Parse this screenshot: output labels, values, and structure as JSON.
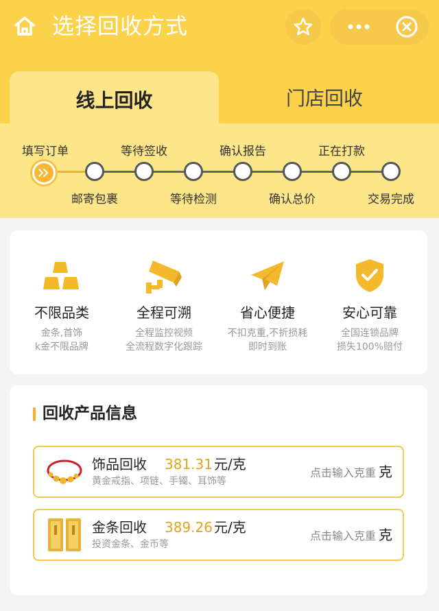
{
  "header": {
    "title": "选择回收方式",
    "icons": {
      "home": "home-icon",
      "favorite": "star-icon",
      "more": "more-icon",
      "close": "close-icon"
    }
  },
  "tabs": [
    {
      "label": "线上回收",
      "active": true
    },
    {
      "label": "门店回收",
      "active": false
    }
  ],
  "steps": [
    {
      "label": "填写订单",
      "current": true
    },
    {
      "label": "邮寄包裹"
    },
    {
      "label": "等待签收"
    },
    {
      "label": "等待检测"
    },
    {
      "label": "确认报告"
    },
    {
      "label": "确认总价"
    },
    {
      "label": "正在打款"
    },
    {
      "label": "交易完成"
    }
  ],
  "features": [
    {
      "icon": "gold-bars-icon",
      "title": "不限品类",
      "desc1": "金条,首饰",
      "desc2": "k金不限品牌"
    },
    {
      "icon": "camera-icon",
      "title": "全程可溯",
      "desc1": "全程监控视频",
      "desc2": "全流程数字化跟踪"
    },
    {
      "icon": "paper-plane-icon",
      "title": "省心便捷",
      "desc1": "不扣克重,不折损耗",
      "desc2": "即时到账"
    },
    {
      "icon": "shield-check-icon",
      "title": "安心可靠",
      "desc1": "全国连锁品牌",
      "desc2": "损失100%赔付"
    }
  ],
  "products": {
    "title": "回收产品信息",
    "items": [
      {
        "name": "饰品回收",
        "price": "381.31",
        "unit": "元/克",
        "desc": "黄金戒指、项链、手镯、耳饰等",
        "placeholder": "点击输入克重",
        "weight_unit": "克"
      },
      {
        "name": "金条回收",
        "price": "389.26",
        "unit": "元/克",
        "desc": "投资金条、金币等",
        "placeholder": "点击输入克重",
        "weight_unit": "克"
      }
    ]
  },
  "colors": {
    "primary": "#fdd24b",
    "accent": "#f2b233",
    "price": "#e2a417"
  }
}
